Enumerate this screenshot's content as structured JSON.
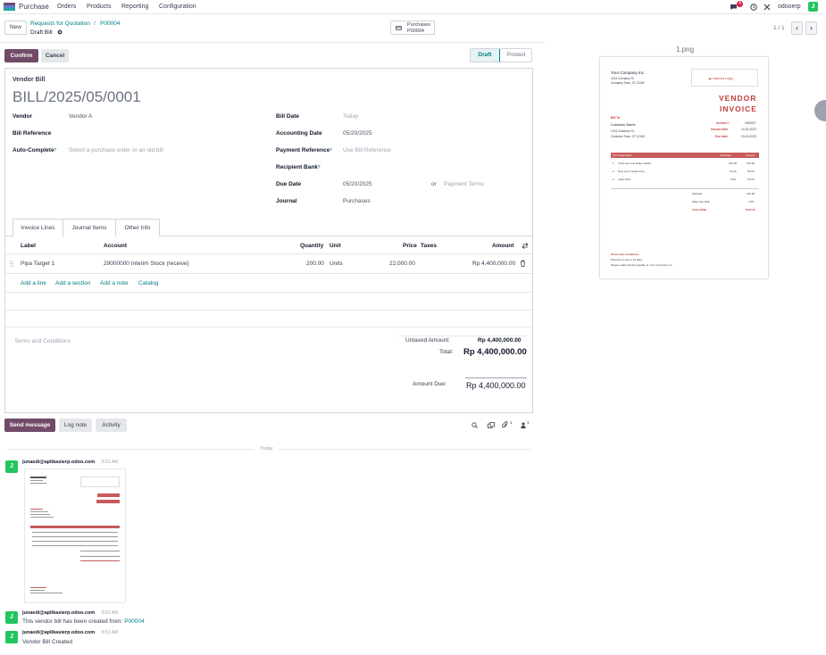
{
  "nav": {
    "brand": "Purchase",
    "menu": [
      "Orders",
      "Products",
      "Reporting",
      "Configuration"
    ],
    "messages_count": "4",
    "company": "odooerp",
    "user_initial": "J"
  },
  "control": {
    "new_label": "New",
    "breadcrumb_parent": "Requests for Quotation",
    "breadcrumb_sep": "/",
    "breadcrumb_current": "P00004",
    "record_name": "Draft Bill",
    "smart_button_label": "Purchases",
    "smart_button_value": "P00004",
    "pager": "1 / 1"
  },
  "actions": {
    "confirm": "Confirm",
    "cancel": "Cancel",
    "status_draft": "Draft",
    "status_posted": "Posted"
  },
  "form": {
    "type_label": "Vendor Bill",
    "bill_number": "BILL/2025/05/0001",
    "vendor_label": "Vendor",
    "vendor_value": "Vendor A",
    "bill_reference_label": "Bill Reference",
    "auto_complete_label": "Auto-Complete",
    "auto_complete_help": "?",
    "auto_complete_placeholder": "Select a purchase order or an old bill",
    "bill_date_label": "Bill Date",
    "bill_date_placeholder": "Today",
    "accounting_date_label": "Accounting Date",
    "accounting_date_value": "05/20/2025",
    "payment_reference_label": "Payment Reference",
    "payment_reference_help": "?",
    "payment_reference_placeholder": "Use Bill Reference",
    "recipient_bank_label": "Recipient Bank",
    "recipient_bank_help": "?",
    "due_date_label": "Due Date",
    "due_date_value": "05/20/2025",
    "due_or": "or",
    "payment_terms_placeholder": "Payment Terms",
    "journal_label": "Journal",
    "journal_value": "Purchases"
  },
  "tabs": [
    "Invoice Lines",
    "Journal Items",
    "Other Info"
  ],
  "lines": {
    "headers": {
      "label": "Label",
      "account": "Account",
      "quantity": "Quantity",
      "unit": "Unit",
      "price": "Price",
      "taxes": "Taxes",
      "amount": "Amount"
    },
    "rows": [
      {
        "label": "Pipa Target 1",
        "account": "29000000 Interim Stock (receive)",
        "quantity": "200.00",
        "unit": "Units",
        "price": "22,000.00",
        "taxes": "",
        "amount": "Rp 4,400,000.00"
      }
    ],
    "add_line": "Add a line",
    "add_section": "Add a section",
    "add_note": "Add a note",
    "catalog": "Catalog"
  },
  "totals": {
    "terms_placeholder": "Terms and Conditions",
    "untaxed_label": "Untaxed Amount:",
    "untaxed_value": "Rp 4,400,000.00",
    "total_label": "Total:",
    "total_value": "Rp 4,400,000.00",
    "due_label": "Amount Due:",
    "due_value": "Rp 4,400,000.00"
  },
  "chatter": {
    "send_message": "Send message",
    "log_note": "Log note",
    "activity": "Activity",
    "attachments_count": "1",
    "followers_count": "1",
    "day_separator": "Today",
    "messages": [
      {
        "author": "junaedi@aplikasierp.odoo.com",
        "time": "8:51 AM",
        "body": "",
        "link": ""
      },
      {
        "author": "junaedi@aplikasierp.odoo.com",
        "time": "8:51 AM",
        "body": "This vendor bill has been created from:",
        "link": "P00004"
      },
      {
        "author": "junaedi@aplikasierp.odoo.com",
        "time": "8:51 AM",
        "body": "Vendor Bill Created",
        "link": ""
      }
    ]
  },
  "preview": {
    "filename": "1.png",
    "company": "Your Company Inc.",
    "address1": "1234 Company St,",
    "address2": "Company Town, ST 12345",
    "upload_logo": "Upload Logo",
    "title1": "VENDOR",
    "title2": "INVOICE",
    "bill_to": "Bill To",
    "customer": "Customer Name",
    "cust_addr1": "1234 Customer St,",
    "cust_addr2": "Customer Town, ST 12345",
    "invoice_no_label": "Invoice #",
    "invoice_no": "0000007",
    "invoice_date_label": "Invoice date",
    "invoice_date": "10-02-2023",
    "due_date_label": "Due date",
    "due_date": "10-16-2023",
    "col_qty_desc": "QTY  Description",
    "col_unit_price": "Unit Price",
    "col_amount": "Amount",
    "items": [
      {
        "qty": "1",
        "desc": "Front and rear brake cables",
        "price": "100.00",
        "amount": "100.00"
      },
      {
        "qty": "2",
        "desc": "New set of pedal arms",
        "price": "15.00",
        "amount": "30.00"
      },
      {
        "qty": "3",
        "desc": "Labor 3hrs",
        "price": "5.00",
        "amount": "15.00"
      }
    ],
    "subtotal_label": "Subtotal",
    "subtotal": "145.00",
    "tax_label": "Sales Tax (5%)",
    "tax": "7.25",
    "total_label": "Total (USD)",
    "total": "$152.25",
    "terms_title": "Terms and Conditions",
    "terms_line1": "Payment is due in 14 days",
    "terms_line2": "Please make checks payable to: Your Company Inc."
  },
  "colors": {
    "primary": "#714b67",
    "link": "#017e84",
    "accent_red": "#c75b5b",
    "avatar": "#22c55e"
  }
}
